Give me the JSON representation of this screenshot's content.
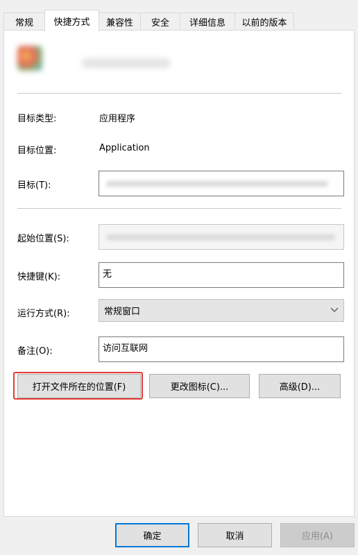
{
  "tabs": [
    {
      "label": "常规"
    },
    {
      "label": "快捷方式"
    },
    {
      "label": "兼容性"
    },
    {
      "label": "安全"
    },
    {
      "label": "详细信息"
    },
    {
      "label": "以前的版本"
    }
  ],
  "shortcut": {
    "target_type_label": "目标类型:",
    "target_type_value": "应用程序",
    "target_location_label": "目标位置:",
    "target_location_value": "Application",
    "target_label": "目标(T):",
    "start_in_label": "起始位置(S):",
    "shortcut_key_label": "快捷键(K):",
    "shortcut_key_value": "无",
    "run_label": "运行方式(R):",
    "run_value": "常规窗口",
    "comment_label": "备注(O):",
    "comment_value": "访问互联网"
  },
  "actions": {
    "open_location": "打开文件所在的位置(F)",
    "change_icon": "更改图标(C)...",
    "advanced": "高级(D)..."
  },
  "footer": {
    "ok": "确定",
    "cancel": "取消",
    "apply": "应用(A)"
  },
  "colors": {
    "highlight_box": "#e53935",
    "primary_button_border": "#0078d7"
  }
}
